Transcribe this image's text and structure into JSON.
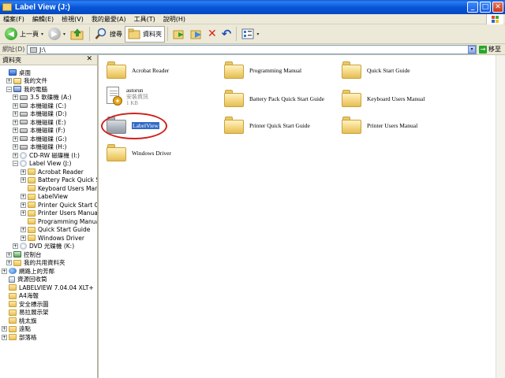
{
  "window": {
    "title": "Label View (J:)",
    "minimize_glyph": "_",
    "maximize_glyph": "□",
    "close_glyph": "✕"
  },
  "menu": [
    "檔案(F)",
    "編輯(E)",
    "檢視(V)",
    "我的最愛(A)",
    "工具(T)",
    "說明(H)"
  ],
  "toolbar": {
    "back_label": "上一頁",
    "back_glyph": "◀",
    "forward_glyph": "▶",
    "search_label": "搜尋",
    "folders_label": "資料夾",
    "dropdown_glyph": "▾",
    "delete_glyph": "✕",
    "undo_glyph": "↶"
  },
  "address": {
    "label": "網址(D)",
    "value": "J:\\",
    "go_label": "移至",
    "go_glyph": "→"
  },
  "folder_pane": {
    "header": "資料夾",
    "close_glyph": "✕",
    "tree": [
      {
        "label": "桌面",
        "icon": "desk-icon",
        "expander": ""
      },
      {
        "label": "我的文件",
        "icon": "docs-icon",
        "expander": "+"
      },
      {
        "label": "我的電腦",
        "icon": "pc-icon",
        "expander": "−"
      },
      {
        "label": "3.5 軟碟機 (A:)",
        "icon": "floppy-icon",
        "expander": "+"
      },
      {
        "label": "本機磁碟 (C:)",
        "icon": "drive-icon",
        "expander": "+"
      },
      {
        "label": "本機磁碟 (D:)",
        "icon": "drive-icon",
        "expander": "+"
      },
      {
        "label": "本機磁碟 (E:)",
        "icon": "drive-icon",
        "expander": "+"
      },
      {
        "label": "本機磁碟 (F:)",
        "icon": "drive-icon",
        "expander": "+"
      },
      {
        "label": "本機磁碟 (G:)",
        "icon": "drive-icon",
        "expander": "+"
      },
      {
        "label": "本機磁碟 (H:)",
        "icon": "drive-icon",
        "expander": "+"
      },
      {
        "label": "CD-RW 磁碟機 (I:)",
        "icon": "cd-icon",
        "expander": "+"
      },
      {
        "label": "Label View (J:)",
        "icon": "cd-icon",
        "expander": "−"
      },
      {
        "label": "Acrobat Reader",
        "icon": "folder-icon",
        "expander": "+"
      },
      {
        "label": "Battery Pack Quick Start G",
        "icon": "folder-icon",
        "expander": "+"
      },
      {
        "label": "Keyboard Users Manual",
        "icon": "folder-icon",
        "expander": ""
      },
      {
        "label": "LabelView",
        "icon": "folder-icon",
        "expander": "+"
      },
      {
        "label": "Printer Quick Start Guide",
        "icon": "folder-icon",
        "expander": "+"
      },
      {
        "label": "Printer Users Manual",
        "icon": "folder-icon",
        "expander": "+"
      },
      {
        "label": "Programming Manual",
        "icon": "folder-icon",
        "expander": ""
      },
      {
        "label": "Quick Start Guide",
        "icon": "folder-icon",
        "expander": "+"
      },
      {
        "label": "Windows Driver",
        "icon": "folder-icon",
        "expander": "+"
      },
      {
        "label": "DVD 光碟機 (K:)",
        "icon": "cd-icon",
        "expander": "+"
      },
      {
        "label": "控制台",
        "icon": "control-panel-icon",
        "expander": "+"
      },
      {
        "label": "我的共用資料夾",
        "icon": "folder-icon",
        "expander": "+"
      },
      {
        "label": "網路上的芳鄰",
        "icon": "network-icon",
        "expander": "+"
      },
      {
        "label": "資源回收筒",
        "icon": "recycle-bin-icon",
        "expander": ""
      },
      {
        "label": "LABELVIEW 7.04.04 XLT+",
        "icon": "folder-icon",
        "expander": ""
      },
      {
        "label": "A4海報",
        "icon": "folder-icon",
        "expander": ""
      },
      {
        "label": "安全標示圖",
        "icon": "folder-icon",
        "expander": ""
      },
      {
        "label": "易拉展示架",
        "icon": "folder-icon",
        "expander": ""
      },
      {
        "label": "桃太旗",
        "icon": "folder-icon",
        "expander": ""
      },
      {
        "label": "遠點",
        "icon": "folder-icon",
        "expander": "+"
      },
      {
        "label": "部落格",
        "icon": "folder-icon",
        "expander": "+"
      }
    ]
  },
  "content_items": [
    {
      "label": "Acrobat Reader",
      "kind": "folder"
    },
    {
      "label": "Programming Manual",
      "kind": "folder"
    },
    {
      "label": "Quick Start Guide",
      "kind": "folder"
    },
    {
      "label": "Battery Pack Quick Start Guide",
      "kind": "folder"
    },
    {
      "label": "Keyboard Users Manual",
      "kind": "folder"
    },
    {
      "label": "LabelView",
      "kind": "folder-selected"
    },
    {
      "label": "Printer Quick Start Guide",
      "kind": "folder"
    },
    {
      "label": "Printer Users Manual",
      "kind": "folder"
    },
    {
      "label": "Windows Driver",
      "kind": "folder"
    }
  ],
  "autorun_file": {
    "name": "autorun",
    "type": "安裝資訊",
    "size": "1 KB"
  },
  "colors": {
    "titlebar": "#0757d8",
    "selection": "#316ac5",
    "highlight_circle": "#d0201c",
    "chrome": "#ece9d8"
  }
}
